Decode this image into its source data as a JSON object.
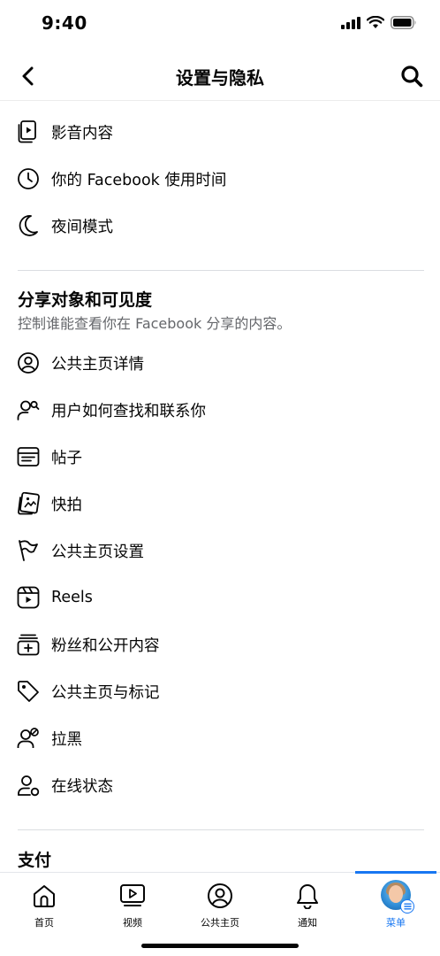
{
  "status_bar": {
    "time": "9:40"
  },
  "nav": {
    "title": "设置与隐私"
  },
  "top_items": [
    {
      "label": "影音内容",
      "icon": "media-icon"
    },
    {
      "label": "你的 Facebook 使用时间",
      "icon": "clock-icon"
    },
    {
      "label": "夜间模式",
      "icon": "moon-icon"
    }
  ],
  "section_audience": {
    "title": "分享对象和可见度",
    "description": "控制谁能查看你在 Facebook 分享的内容。",
    "items": [
      {
        "label": "公共主页详情",
        "icon": "profile-circle-icon"
      },
      {
        "label": "用户如何查找和联系你",
        "icon": "person-search-icon"
      },
      {
        "label": "帖子",
        "icon": "post-icon"
      },
      {
        "label": "快拍",
        "icon": "stories-icon"
      },
      {
        "label": "公共主页设置",
        "icon": "flag-icon"
      },
      {
        "label": "Reels",
        "icon": "reels-icon"
      },
      {
        "label": "粉丝和公开内容",
        "icon": "followers-icon"
      },
      {
        "label": "公共主页与标记",
        "icon": "tag-icon"
      },
      {
        "label": "拉黑",
        "icon": "block-user-icon"
      },
      {
        "label": "在线状态",
        "icon": "active-status-icon"
      }
    ]
  },
  "section_payments": {
    "title": "支付"
  },
  "tab_bar": {
    "tabs": [
      {
        "label": "首页",
        "icon": "home-icon"
      },
      {
        "label": "视频",
        "icon": "video-icon"
      },
      {
        "label": "公共主页",
        "icon": "profile-icon"
      },
      {
        "label": "通知",
        "icon": "bell-icon"
      },
      {
        "label": "菜单",
        "icon": "avatar-menu-icon"
      }
    ],
    "active_index": 4
  },
  "colors": {
    "accent": "#1877f2",
    "secondary_text": "#65676b",
    "divider": "#dadde1"
  }
}
